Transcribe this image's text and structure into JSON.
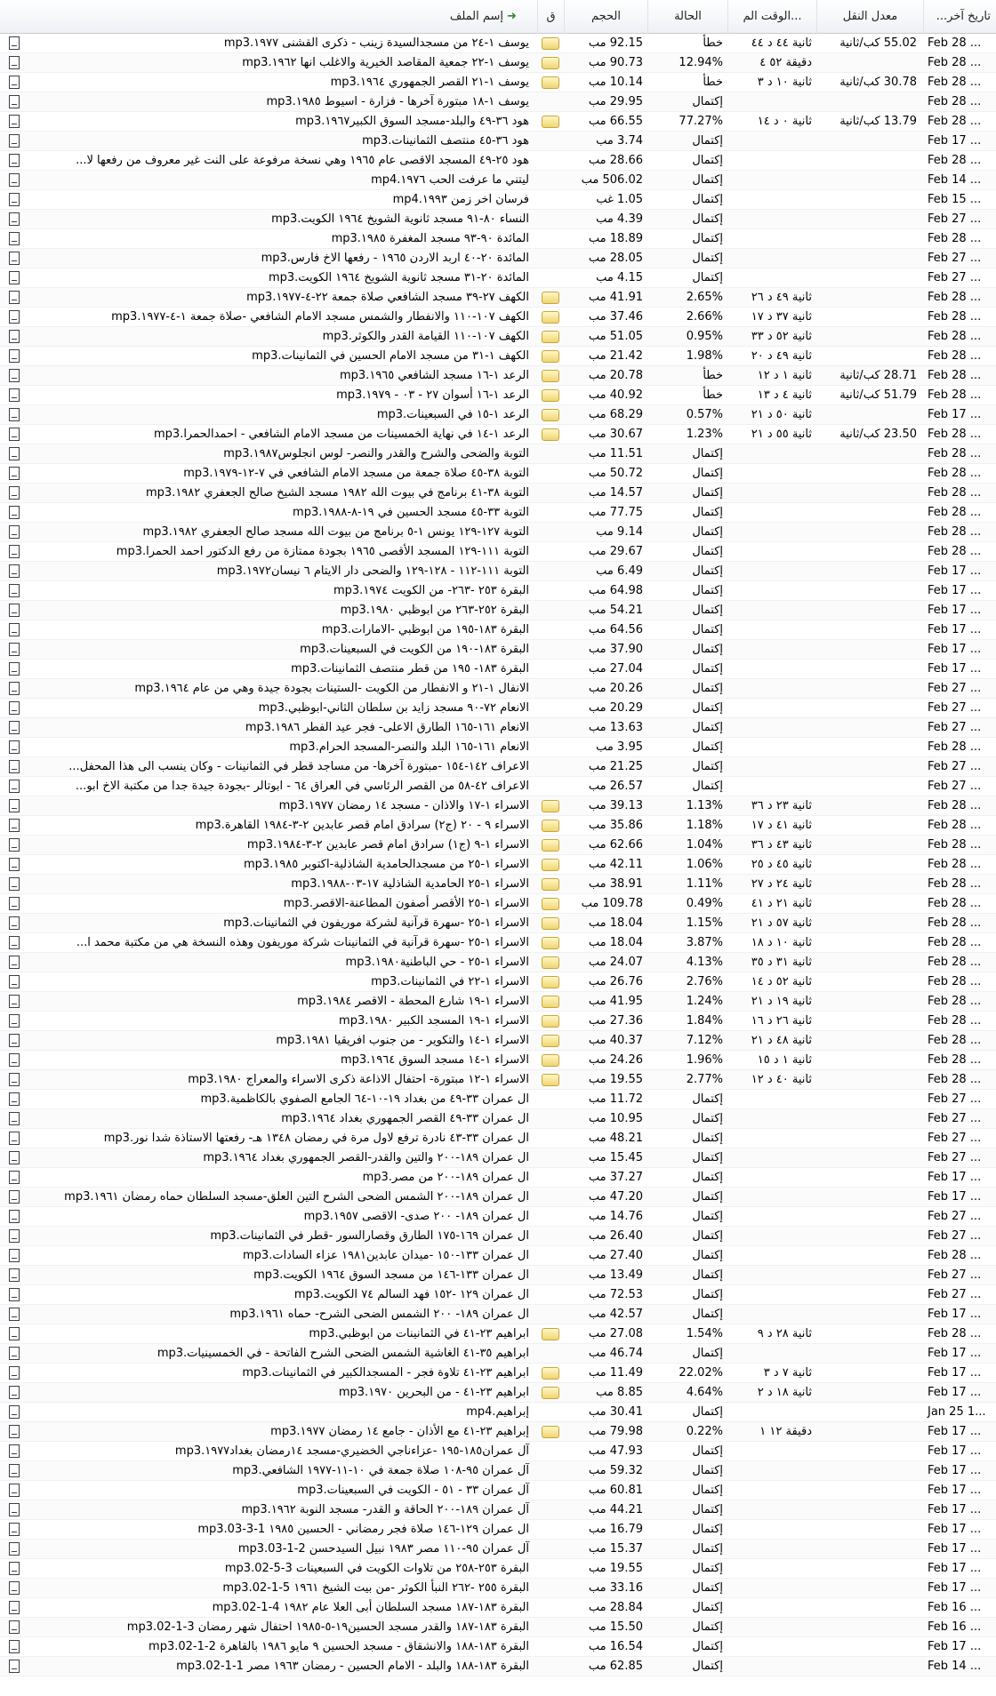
{
  "headers": {
    "date": "تاريخ آخر...",
    "rate": "معدل النقل",
    "time": "...الوقت الم",
    "status": "الحالة",
    "size": "الحجم",
    "queue": "ق",
    "name": "إسم الملف",
    "sort_icon": "refresh-arrow-icon"
  },
  "rows": [
    {
      "name": "يوسف ١-٢٤ من مسجدالسيدة زينب - ذكرى القشنى ١٩٧٧.mp3",
      "size": "92.15 مب",
      "status": "خطأ",
      "time": "ثانية ٤٤ د ٤٤",
      "rate": "55.02 كب/ثانية",
      "date": "Feb 28 ...",
      "q": true
    },
    {
      "name": "يوسف ١-٢٢ جمعية المقاصد الخيرية والاغلب انها ١٩٦٢.mp3",
      "size": "90.73 مب",
      "status": "12.94%",
      "time": "دقيقة ٥٢ ٤",
      "rate": "",
      "date": "Feb 28 ...",
      "q": true
    },
    {
      "name": "يوسف ١-٢١ القصر الجمهوري ١٩٦٤.mp3",
      "size": "10.14 مب",
      "status": "خطأ",
      "time": "ثانية ١٠ د ٣",
      "rate": "30.78 كب/ثانية",
      "date": "Feb 28 ...",
      "q": true
    },
    {
      "name": "يوسف ١-١٨ مبتورة آخرها - فزارة - اسيوط ١٩٨٥.mp3",
      "size": "29.95 مب",
      "status": "إكتمال",
      "time": "",
      "rate": "",
      "date": "Feb 28 ...",
      "q": false
    },
    {
      "name": "هود ٣٦-٤٩ والبلد-مسجد السوق الكبير١٩٦٧.mp3",
      "size": "66.55 مب",
      "status": "77.27%",
      "time": "ثانية ٠ د ١٤",
      "rate": "13.79 كب/ثانية",
      "date": "Feb 28 ...",
      "q": true
    },
    {
      "name": "هود ٣٦-٤٥ منتصف الثمانينات.mp3",
      "size": "3.74 مب",
      "status": "إكتمال",
      "time": "",
      "rate": "",
      "date": "Feb 17 ...",
      "q": false
    },
    {
      "name": "هود ٢٥-٤٩ المسجد الاقصى عام ١٩٦٥ وهي نسخة مرفوعة على النت غير معروف من رفعها لا...",
      "size": "28.66 مب",
      "status": "إكتمال",
      "time": "",
      "rate": "",
      "date": "Feb 28 ...",
      "q": false
    },
    {
      "name": "ليتني ما عرفت الحب ١٩٧٦.mp4",
      "size": "506.02 مب",
      "status": "إكتمال",
      "time": "",
      "rate": "",
      "date": "Feb 14 ...",
      "q": false
    },
    {
      "name": "فرسان اخر زمن ١٩٩٣.mp4",
      "size": "1.05 غب",
      "status": "إكتمال",
      "time": "",
      "rate": "",
      "date": "Feb 15 ...",
      "q": false
    },
    {
      "name": "النساء ٨٠-٩١ مسجد ثانوية الشويخ ١٩٦٤ الكويت.mp3",
      "size": "4.39 مب",
      "status": "إكتمال",
      "time": "",
      "rate": "",
      "date": "Feb 27 ...",
      "q": false
    },
    {
      "name": "المائدة ٩٠-٩٣ مسجد المغفرة ١٩٨٥.mp3",
      "size": "18.89 مب",
      "status": "إكتمال",
      "time": "",
      "rate": "",
      "date": "Feb 28 ...",
      "q": false
    },
    {
      "name": "المائدة ٢٠-٤٠ اربد الاردن ١٩٦٥ - رفعها الاخ فارس.mp3",
      "size": "28.05 مب",
      "status": "إكتمال",
      "time": "",
      "rate": "",
      "date": "Feb 27 ...",
      "q": false
    },
    {
      "name": "المائدة ٢٠-٣١ مسجد ثانوية الشويخ ١٩٦٤ الكويت.mp3",
      "size": "4.15 مب",
      "status": "إكتمال",
      "time": "",
      "rate": "",
      "date": "Feb 27 ...",
      "q": false
    },
    {
      "name": "الكهف ٢٧-٣٩ مسجد الشافعي صلاة جمعة ٢٢-٤-١٩٧٧.mp3",
      "size": "41.91 مب",
      "status": "2.65%",
      "time": "ثانية ٤٩ د ٢٦",
      "rate": "",
      "date": "Feb 28 ...",
      "q": true
    },
    {
      "name": "الكهف ١٠٧-١١٠ والانفطار والشمس مسجد الامام الشافعي -صلاة جمعة ١-٤-١٩٧٧.mp3",
      "size": "37.46 مب",
      "status": "2.66%",
      "time": "ثانية ٣٧ د ١٧",
      "rate": "",
      "date": "Feb 28 ...",
      "q": true
    },
    {
      "name": "الكهف ١٠٧-١١٠ القيامة القدر والكوثر.mp3",
      "size": "51.05 مب",
      "status": "0.95%",
      "time": "ثانية ٥٢ د ٣٣",
      "rate": "",
      "date": "Feb 28 ...",
      "q": true
    },
    {
      "name": "الكهف ١-٣١ من مسجد الامام الحسين في الثمانينات.mp3",
      "size": "21.42 مب",
      "status": "1.98%",
      "time": "ثانية ٤٩ د ٢٠",
      "rate": "",
      "date": "Feb 28 ...",
      "q": true
    },
    {
      "name": "الرعد ١-١٦ مسجد الشافعي ١٩٦٥.mp3",
      "size": "20.78 مب",
      "status": "خطأ",
      "time": "ثانية ١ د ١٢",
      "rate": "28.71 كب/ثانية",
      "date": "Feb 28 ...",
      "q": true
    },
    {
      "name": "الرعد ١-١٦ أسوان ٢٧ - ٠٣ - ١٩٧٩.mp3",
      "size": "40.92 مب",
      "status": "خطأ",
      "time": "ثانية ٤ د ١٣",
      "rate": "51.79 كب/ثانية",
      "date": "Feb 28 ...",
      "q": true
    },
    {
      "name": "الرعد ١-١٥ في السبعينات.mp3",
      "size": "68.29 مب",
      "status": "0.57%",
      "time": "ثانية ٥٠ د ٢١",
      "rate": "",
      "date": "Feb 17 ...",
      "q": true
    },
    {
      "name": "الرعد ١-١٤ في نهاية الخمسينات من مسجد الامام الشافعي - احمدالحمرا.mp3",
      "size": "30.67 مب",
      "status": "1.23%",
      "time": "ثانية ٥٥ د ٢١",
      "rate": "23.50 كب/ثانية",
      "date": "Feb 28 ...",
      "q": true
    },
    {
      "name": "التوبة والضحى والشرح والقدر والنصر- لوس انجلوس١٩٨٧.mp3",
      "size": "11.51 مب",
      "status": "إكتمال",
      "time": "",
      "rate": "",
      "date": "Feb 28 ...",
      "q": false
    },
    {
      "name": "التوبة ٣٨-٤٥ صلاة جمعة من مسجد الامام الشافعي في ٧-١٢-١٩٧٩.mp3",
      "size": "50.72 مب",
      "status": "إكتمال",
      "time": "",
      "rate": "",
      "date": "Feb 28 ...",
      "q": false
    },
    {
      "name": "التوبة ٣٨-٤١ برنامج في بيوت الله ١٩٨٢ مسجد الشيخ صالح الجعفري ١٩٨٢.mp3",
      "size": "14.57 مب",
      "status": "إكتمال",
      "time": "",
      "rate": "",
      "date": "Feb 28 ...",
      "q": false
    },
    {
      "name": "التوبة ٣٣-٤٥ مسجد الحسين في ١٩-٨-١٩٨٨.mp3",
      "size": "77.75 مب",
      "status": "إكتمال",
      "time": "",
      "rate": "",
      "date": "Feb 28 ...",
      "q": false
    },
    {
      "name": "التوبة ١٢٧-١٢٩ يونس ١-٥ برنامج من بيوت الله مسجد صالح الجعفري ١٩٨٢.mp3",
      "size": "9.14 مب",
      "status": "إكتمال",
      "time": "",
      "rate": "",
      "date": "Feb 28 ...",
      "q": false
    },
    {
      "name": "التوبة ١١١-١٢٩ المسجد الأقصى ١٩٦٥ بجودة ممتازة من رفع الدكتور احمد الحمرا.mp3",
      "size": "29.67 مب",
      "status": "إكتمال",
      "time": "",
      "rate": "",
      "date": "Feb 28 ...",
      "q": false
    },
    {
      "name": "التوبة ١١١-١١٢ - ١٢٨-١٢٩ والضحى دار الايتام ٦ نيسان١٩٧٢.mp3",
      "size": "6.49 مب",
      "status": "إكتمال",
      "time": "",
      "rate": "",
      "date": "Feb 17 ...",
      "q": false
    },
    {
      "name": "البقرة ٢٥٣ -٢٦٣- من الكويت ١٩٧٤.mp3",
      "size": "64.98 مب",
      "status": "إكتمال",
      "time": "",
      "rate": "",
      "date": "Feb 17 ...",
      "q": false
    },
    {
      "name": "البقرة ٢٥٢-٢٦٣ من ابوظبي ١٩٨٠.mp3",
      "size": "54.21 مب",
      "status": "إكتمال",
      "time": "",
      "rate": "",
      "date": "Feb 17 ...",
      "q": false
    },
    {
      "name": "البقرة ١٨٣-١٩٥ من ابوظبي -الامارات.mp3",
      "size": "64.56 مب",
      "status": "إكتمال",
      "time": "",
      "rate": "",
      "date": "Feb 17 ...",
      "q": false
    },
    {
      "name": "البقرة ١٨٣-١٩٠ من الكويت في السبعينات.mp3",
      "size": "37.90 مب",
      "status": "إكتمال",
      "time": "",
      "rate": "",
      "date": "Feb 17 ...",
      "q": false
    },
    {
      "name": "البقرة ١٨٣- ١٩٥ من قطر منتصف الثمانينات.mp3",
      "size": "27.04 مب",
      "status": "إكتمال",
      "time": "",
      "rate": "",
      "date": "Feb 17 ...",
      "q": false
    },
    {
      "name": "الانفال ١-٢١ و الانفطار من الكويت -الستينات بجودة جيدة وهي من عام ١٩٦٤.mp3",
      "size": "20.26 مب",
      "status": "إكتمال",
      "time": "",
      "rate": "",
      "date": "Feb 27 ...",
      "q": false
    },
    {
      "name": "الانعام ٧٢-٩٠ مسجد زايد بن سلطان الثاني-ابوظبي.mp3",
      "size": "20.29 مب",
      "status": "إكتمال",
      "time": "",
      "rate": "",
      "date": "Feb 27 ...",
      "q": false
    },
    {
      "name": "الانعام ١٦١-١٦٥ الطارق الاعلى- فجر عيد الفطر ١٩٨٦.mp3",
      "size": "13.63 مب",
      "status": "إكتمال",
      "time": "",
      "rate": "",
      "date": "Feb 27 ...",
      "q": false
    },
    {
      "name": "الانعام ١٦١-١٦٥ البلد والنصر-المسجد الحرام.mp3",
      "size": "3.95 مب",
      "status": "إكتمال",
      "time": "",
      "rate": "",
      "date": "Feb 28 ...",
      "q": false
    },
    {
      "name": "الاعراف ١٤٢-١٥٤ -مبتورة آخرها- من مساجد قطر في الثمانينات - وكان ينسب الى هذا المحفل...",
      "size": "21.25 مب",
      "status": "إكتمال",
      "time": "",
      "rate": "",
      "date": "Feb 27 ...",
      "q": false
    },
    {
      "name": "الاعراف ٤٢-٥٨ من القصر الرئاسي في العراق ٦٤ - ابوتالر -بجودة جيدة جدا من مكتبة الاخ ابو...",
      "size": "26.57 مب",
      "status": "إكتمال",
      "time": "",
      "rate": "",
      "date": "Feb 27 ...",
      "q": false
    },
    {
      "name": "الاسراء ١-١٧ والاذان - مسجد ١٤ رمضان ١٩٧٧.mp3",
      "size": "39.13 مب",
      "status": "1.13%",
      "time": "ثانية ٢٣ د ٣٦",
      "rate": "",
      "date": "Feb 28 ...",
      "q": true
    },
    {
      "name": "الاسراء ٩ - ٢٠ (ج٢) سرادق امام قصر عابدين ٢-٣-١٩٨٤ القاهرة.mp3",
      "size": "35.86 مب",
      "status": "1.18%",
      "time": "ثانية ٤١ د ١٧",
      "rate": "",
      "date": "Feb 28 ...",
      "q": true
    },
    {
      "name": "الاسراء ١-٩ (ج١) سرادق امام قصر عابدين ٢-٣-١٩٨٤.mp3",
      "size": "62.66 مب",
      "status": "1.04%",
      "time": "ثانية ٤٣ د ٣٦",
      "rate": "",
      "date": "Feb 28 ...",
      "q": true
    },
    {
      "name": "الاسراء ١-٢٥ من مسجدالحامدية الشاذلية-اكتوبر ١٩٨٥.mp3",
      "size": "42.11 مب",
      "status": "1.06%",
      "time": "ثانية ٤٥ د ٢٥",
      "rate": "",
      "date": "Feb 28 ...",
      "q": true
    },
    {
      "name": "الاسراء ١-٢٥ الحامدية الشاذلية ١٧-٠٣-١٩٨٨.mp3",
      "size": "38.91 مب",
      "status": "1.11%",
      "time": "ثانية ٢٤ د ٢٧",
      "rate": "",
      "date": "Feb 28 ...",
      "q": true
    },
    {
      "name": "الاسراء ١-٢٥ الأقصر أصفون المطاعنة-الاقصر.mp3",
      "size": "109.78 مب",
      "status": "0.49%",
      "time": "ثانية ٢١ د ٤١",
      "rate": "",
      "date": "Feb 28 ...",
      "q": true
    },
    {
      "name": "الاسراء ١-٢٥ -سهرة قرآنية لشركة موريفون في الثمانينات.mp3",
      "size": "18.04 مب",
      "status": "1.15%",
      "time": "ثانية ٥٧ د ٢١",
      "rate": "",
      "date": "Feb 28 ...",
      "q": true
    },
    {
      "name": "الاسراء ١-٢٥ -سهرة قرآنية في الثمانينات شركة موريفون وهذه النسخة هي من مكتبة محمد ا...",
      "size": "18.04 مب",
      "status": "3.87%",
      "time": "ثانية ١٠ د ١٨",
      "rate": "",
      "date": "Feb 28 ...",
      "q": true
    },
    {
      "name": "الاسراء ١-٢٥ - حي الباطنية١٩٨٠.mp3",
      "size": "24.07 مب",
      "status": "4.13%",
      "time": "ثانية ٣١ د ٣٥",
      "rate": "",
      "date": "Feb 28 ...",
      "q": true
    },
    {
      "name": "الاسراء ١-٢٢ في الثمانينات.mp3",
      "size": "26.76 مب",
      "status": "2.76%",
      "time": "ثانية ٥٢ د ١٤",
      "rate": "",
      "date": "Feb 28 ...",
      "q": true
    },
    {
      "name": "الاسراء ١-١٩ شارع المحطة - الاقصر ١٩٨٤.mp3",
      "size": "41.95 مب",
      "status": "1.24%",
      "time": "ثانية ١٩ د ٢١",
      "rate": "",
      "date": "Feb 28 ...",
      "q": true
    },
    {
      "name": "الاسراء ١-١٩ المسجد الكبير ١٩٨٠.mp3",
      "size": "27.36 مب",
      "status": "1.84%",
      "time": "ثانية ٢٦ د ١٦",
      "rate": "",
      "date": "Feb 28 ...",
      "q": true
    },
    {
      "name": "الاسراء ١-١٤ والتكوير - من جنوب افريقيا ١٩٨١.mp3",
      "size": "40.37 مب",
      "status": "7.12%",
      "time": "ثانية ٤٨ د ٢١",
      "rate": "",
      "date": "Feb 28 ...",
      "q": true
    },
    {
      "name": "الاسراء ١-١٤ مسجد السوق ١٩٦٤.mp3",
      "size": "24.26 مب",
      "status": "1.96%",
      "time": "ثانية ١ د ١٥",
      "rate": "",
      "date": "Feb 28 ...",
      "q": true
    },
    {
      "name": "الاسراء ١-١٢ مبتورة- احتفال الاذاعة ذكرى الاسراء والمعراج ١٩٨٠.mp3",
      "size": "19.55 مب",
      "status": "2.77%",
      "time": "ثانية ٤٠ د ١٢",
      "rate": "",
      "date": "Feb 28 ...",
      "q": true
    },
    {
      "name": "ال عمران ٣٣-٤٩ من بغداد ١٩-١٠-٦٤ الجامع الصفوي بالكاظمية.mp3",
      "size": "11.72 مب",
      "status": "إكتمال",
      "time": "",
      "rate": "",
      "date": "Feb 27 ...",
      "q": false
    },
    {
      "name": "ال عمران ٣٣-٤٩ القصر الجمهوري بغداد ١٩٦٤.mp3",
      "size": "10.95 مب",
      "status": "إكتمال",
      "time": "",
      "rate": "",
      "date": "Feb 27 ...",
      "q": false
    },
    {
      "name": "ال عمران ٣٣-٤٣ نادرة ترفع لاول مرة في رمضان ١٣٤٨ هـ- رفعتها الاستاذة شدا نور.mp3",
      "size": "48.21 مب",
      "status": "إكتمال",
      "time": "",
      "rate": "",
      "date": "Feb 27 ...",
      "q": false
    },
    {
      "name": "ال عمران ١٨٩-٢٠٠ والتين والقدر-القصر الجمهوري بغداد ١٩٦٤.mp3",
      "size": "15.45 مب",
      "status": "إكتمال",
      "time": "",
      "rate": "",
      "date": "Feb 27 ...",
      "q": false
    },
    {
      "name": "ال عمران ١٨٩-٢٠٠ من مصر.mp3",
      "size": "37.27 مب",
      "status": "إكتمال",
      "time": "",
      "rate": "",
      "date": "Feb 17 ...",
      "q": false
    },
    {
      "name": "ال عمران ١٨٩-٢٠٠ الشمس الضحى الشرح التين العلق-مسجد السلطان حماه رمضان ١٩٦١.mp3",
      "size": "47.20 مب",
      "status": "إكتمال",
      "time": "",
      "rate": "",
      "date": "Feb 17 ...",
      "q": false
    },
    {
      "name": "ال عمران ١٨٩- ٢٠٠ صدى- الاقصى ١٩٥٧.mp3",
      "size": "14.76 مب",
      "status": "إكتمال",
      "time": "",
      "rate": "",
      "date": "Feb 27 ...",
      "q": false
    },
    {
      "name": "ال عمران ١٦٩-١٧٥ الطارق وقصارالسور -قطر في الثمانينات.mp3",
      "size": "26.40 مب",
      "status": "إكتمال",
      "time": "",
      "rate": "",
      "date": "Feb 27 ...",
      "q": false
    },
    {
      "name": "ال عمران ١٣٣-١٥٠ -ميدان عابدين١٩٨١ عزاء السادات.mp3",
      "size": "27.40 مب",
      "status": "إكتمال",
      "time": "",
      "rate": "",
      "date": "Feb 28 ...",
      "q": false
    },
    {
      "name": "ال عمران ١٣٣-١٤٦ من مسجد السوق ١٩٦٤ الكويت.mp3",
      "size": "13.49 مب",
      "status": "إكتمال",
      "time": "",
      "rate": "",
      "date": "Feb 27 ...",
      "q": false
    },
    {
      "name": "ال عمران ١٢٩ -١٥٢ فهد السالم ٧٤ الكويت.mp3",
      "size": "72.53 مب",
      "status": "إكتمال",
      "time": "",
      "rate": "",
      "date": "Feb 27 ...",
      "q": false
    },
    {
      "name": "ال عمران ١٨٩- ٢٠٠ الشمس الضحى الشرح- حماه ١٩٦١.mp3",
      "size": "42.57 مب",
      "status": "إكتمال",
      "time": "",
      "rate": "",
      "date": "Feb 17 ...",
      "q": false
    },
    {
      "name": "ابراهيم ٢٣-٤١ في الثمانينات من ابوظبي.mp3",
      "size": "27.08 مب",
      "status": "1.54%",
      "time": "ثانية ٢٨ د ٩",
      "rate": "",
      "date": "Feb 28 ...",
      "q": true
    },
    {
      "name": "ابراهيم ٣٥-٤١ الغاشية الشمس الضحى الشرح الفاتحة - في الخمسينيات.mp3",
      "size": "46.74 مب",
      "status": "إكتمال",
      "time": "",
      "rate": "",
      "date": "Feb 17 ...",
      "q": false
    },
    {
      "name": "ابراهيم ٢٣-٤١ تلاوة فجر - المسجدالكبير في الثمانينات.mp3",
      "size": "11.49 مب",
      "status": "22.02%",
      "time": "ثانية ٧ د ٣",
      "rate": "",
      "date": "Feb 17 ...",
      "q": true
    },
    {
      "name": "ابراهيم ٢٣-٤١ - من البحرين ١٩٧٠.mp3",
      "size": "8.85 مب",
      "status": "4.64%",
      "time": "ثانية ١٨ د ٢",
      "rate": "",
      "date": "Feb 17 ...",
      "q": true
    },
    {
      "name": "إبراهيم.mp4",
      "size": "30.41 مب",
      "status": "إكتمال",
      "time": "",
      "rate": "",
      "date": "Jan 25 1...",
      "q": false
    },
    {
      "name": "إبراهيم ٢٣-٤١ مع الأذان - جامع ١٤ رمضان ١٩٧٧.mp3",
      "size": "79.98 مب",
      "status": "0.22%",
      "time": "دقيقة ١٢ ١",
      "rate": "",
      "date": "Feb 17 ...",
      "q": true
    },
    {
      "name": "آل عمران١٨٥-١٩٥ -عزاءناجي الخضيري-مسجد ١٤رمضان بغداد١٩٧٧.mp3",
      "size": "47.93 مب",
      "status": "إكتمال",
      "time": "",
      "rate": "",
      "date": "Feb 17 ...",
      "q": false
    },
    {
      "name": "آل عمران ٩٥-١٠٨ صلاة جمعة في ١٠-١١-١٩٧٧ الشافعي.mp3",
      "size": "59.32 مب",
      "status": "إكتمال",
      "time": "",
      "rate": "",
      "date": "Feb 17 ...",
      "q": false
    },
    {
      "name": "آل عمران ٣٣ - ٥١ - الكويت في السبعينات.mp3",
      "size": "60.81 مب",
      "status": "إكتمال",
      "time": "",
      "rate": "",
      "date": "Feb 17 ...",
      "q": false
    },
    {
      "name": "آل عمران ١٨٩-٢٠٠ الحاقة و القدر- مسجد النوبة ١٩٦٢.mp3",
      "size": "44.21 مب",
      "status": "إكتمال",
      "time": "",
      "rate": "",
      "date": "Feb 17 ...",
      "q": false
    },
    {
      "name": "ال عمران ١٢٩-١٤٦ صلاة فجر رمضاني - الحسين ١٩٨٥ 1-3-03.mp3",
      "size": "16.79 مب",
      "status": "إكتمال",
      "time": "",
      "rate": "",
      "date": "Feb 17 ...",
      "q": false
    },
    {
      "name": "آل عمران ٩٥-١١٠ مصر ١٩٨٣ نبيل السيدحسن 2-1-03.mp3",
      "size": "15.37 مب",
      "status": "إكتمال",
      "time": "",
      "rate": "",
      "date": "Feb 17 ...",
      "q": false
    },
    {
      "name": "البقرة ٢٥٣-٢٥٨ من تلاوات الكويت في السبعينات 3-5-02.mp3",
      "size": "19.55 مب",
      "status": "إكتمال",
      "time": "",
      "rate": "",
      "date": "Feb 17 ...",
      "q": false
    },
    {
      "name": "البقرة ٢٥٥ -٢٦٢ النبأ الكوثر -من بيت الشيخ ١٩٦١ 5-1-02.mp3",
      "size": "33.16 مب",
      "status": "إكتمال",
      "time": "",
      "rate": "",
      "date": "Feb 17 ...",
      "q": false
    },
    {
      "name": "البقرة ١٨٣-١٨٧ مسجد السلطان أبى العلا عام ١٩٨٢ 4-1-02.mp3",
      "size": "28.84 مب",
      "status": "إكتمال",
      "time": "",
      "rate": "",
      "date": "Feb 16 ...",
      "q": false
    },
    {
      "name": "البقرة ١٨٣-١٨٧ والقدر مسجد الحسين١٩-٥-١٩٨٥ احتفال شهر رمضان 3-1-02.mp3",
      "size": "15.50 مب",
      "status": "إكتمال",
      "time": "",
      "rate": "",
      "date": "Feb 16 ...",
      "q": false
    },
    {
      "name": "البقرة ١٨٣-١٨٨ والانشقاق - مسجد الحسين ٩ مايو ١٩٨٦ بالقاهرة 2-1-02.mp3",
      "size": "16.54 مب",
      "status": "إكتمال",
      "time": "",
      "rate": "",
      "date": "Feb 17 ...",
      "q": false
    },
    {
      "name": "البقرة ١٨٣-١٨٨ والبلد - الامام الحسين - رمضان ١٩٦٣ مصر 1-1-02.mp3",
      "size": "62.85 مب",
      "status": "إكتمال",
      "time": "",
      "rate": "",
      "date": "Feb 14 ...",
      "q": false
    }
  ]
}
